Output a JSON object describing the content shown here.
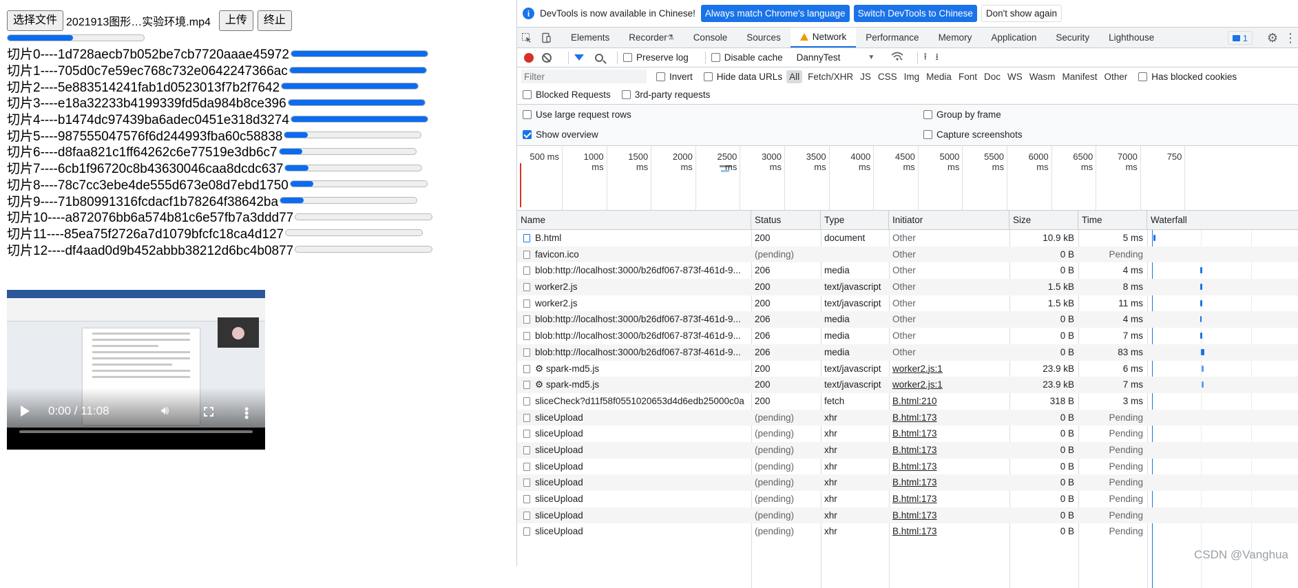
{
  "page": {
    "choose_file_label": "选择文件",
    "file_name": "2021913图形…实验环境.mp4",
    "upload_label": "上传",
    "stop_label": "终止",
    "total_progress": 0.48,
    "slices": [
      {
        "label": "切片0----1d728aecb7b052be7cb7720aaae45972",
        "progress": 1.0
      },
      {
        "label": "切片1----705d0c7e59ec768c732e0642247366ac",
        "progress": 1.0
      },
      {
        "label": "切片2----5e883514241fab1d0523013f7b2f7642",
        "progress": 1.0
      },
      {
        "label": "切片3----e18a32233b4199339fd5da984b8ce396",
        "progress": 1.0
      },
      {
        "label": "切片4----b1474dc97439ba6adec0451e318d3274",
        "progress": 1.0
      },
      {
        "label": "切片5----987555047576f6d244993fba60c58838",
        "progress": 0.17
      },
      {
        "label": "切片6----d8faa821c1ff64262c6e77519e3db6c7",
        "progress": 0.17
      },
      {
        "label": "切片7----6cb1f96720c8b43630046caa8dcdc637",
        "progress": 0.17
      },
      {
        "label": "切片8----78c7cc3ebe4de555d673e08d7ebd1750",
        "progress": 0.17
      },
      {
        "label": "切片9----71b80991316fcdacf1b78264f38642ba",
        "progress": 0.17
      },
      {
        "label": "切片10----a872076bb6a574b81c6e57fb7a3ddd77",
        "progress": 0.0
      },
      {
        "label": "切片11----85ea75f2726a7d1079bfcfc18ca4d127",
        "progress": 0.0
      },
      {
        "label": "切片12----df4aad0d9b452abbb38212d6bc4b0877",
        "progress": 0.0
      }
    ],
    "video": {
      "time": "0:00 / 11:08"
    }
  },
  "devtools": {
    "infobar": {
      "text": "DevTools is now available in Chinese!",
      "btn_match": "Always match Chrome's language",
      "btn_switch": "Switch DevTools to Chinese",
      "btn_dismiss": "Don't show again"
    },
    "tabs": [
      "Elements",
      "Recorder",
      "Console",
      "Sources",
      "Network",
      "Performance",
      "Memory",
      "Application",
      "Security",
      "Lighthouse"
    ],
    "active_tab": "Network",
    "issues_count": "1",
    "toolbar": {
      "preserve_log": "Preserve log",
      "disable_cache": "Disable cache",
      "throttle": "DannyTest"
    },
    "filter": {
      "placeholder": "Filter",
      "invert": "Invert",
      "hide_data_urls": "Hide data URLs",
      "types": [
        "All",
        "Fetch/XHR",
        "JS",
        "CSS",
        "Img",
        "Media",
        "Font",
        "Doc",
        "WS",
        "Wasm",
        "Manifest",
        "Other"
      ],
      "has_blocked_cookies": "Has blocked cookies",
      "blocked_requests": "Blocked Requests",
      "third_party": "3rd-party requests"
    },
    "settings": {
      "large_rows": "Use large request rows",
      "group_by_frame": "Group by frame",
      "show_overview": "Show overview",
      "capture_screenshots": "Capture screenshots"
    },
    "overview_ticks": [
      "500 ms",
      "1000 ms",
      "1500 ms",
      "2000 ms",
      "2500 ms",
      "3000 ms",
      "3500 ms",
      "4000 ms",
      "4500 ms",
      "5000 ms",
      "5500 ms",
      "6000 ms",
      "6500 ms",
      "7000 ms",
      "750"
    ],
    "columns": [
      "Name",
      "Status",
      "Type",
      "Initiator",
      "Size",
      "Time",
      "Waterfall"
    ],
    "rows": [
      {
        "name": "B.html",
        "status": "200",
        "type": "document",
        "initiator": "Other",
        "size": "10.9 kB",
        "time": "5 ms",
        "icon": "doc"
      },
      {
        "name": "favicon.ico",
        "status": "(pending)",
        "type": "",
        "initiator": "Other",
        "size": "0 B",
        "time": "Pending",
        "icon": "file"
      },
      {
        "name": "blob:http://localhost:3000/b26df067-873f-461d-9...",
        "status": "206",
        "type": "media",
        "initiator": "Other",
        "size": "0 B",
        "time": "4 ms",
        "icon": "file"
      },
      {
        "name": "worker2.js",
        "status": "200",
        "type": "text/javascript",
        "initiator": "Other",
        "size": "1.5 kB",
        "time": "8 ms",
        "icon": "file"
      },
      {
        "name": "worker2.js",
        "status": "200",
        "type": "text/javascript",
        "initiator": "Other",
        "size": "1.5 kB",
        "time": "11 ms",
        "icon": "file"
      },
      {
        "name": "blob:http://localhost:3000/b26df067-873f-461d-9...",
        "status": "206",
        "type": "media",
        "initiator": "Other",
        "size": "0 B",
        "time": "4 ms",
        "icon": "file"
      },
      {
        "name": "blob:http://localhost:3000/b26df067-873f-461d-9...",
        "status": "206",
        "type": "media",
        "initiator": "Other",
        "size": "0 B",
        "time": "7 ms",
        "icon": "file"
      },
      {
        "name": "blob:http://localhost:3000/b26df067-873f-461d-9...",
        "status": "206",
        "type": "media",
        "initiator": "Other",
        "size": "0 B",
        "time": "83 ms",
        "icon": "file"
      },
      {
        "name": "⚙ spark-md5.js",
        "status": "200",
        "type": "text/javascript",
        "initiator": "worker2.js:1",
        "size": "23.9 kB",
        "time": "6 ms",
        "icon": "file"
      },
      {
        "name": "⚙ spark-md5.js",
        "status": "200",
        "type": "text/javascript",
        "initiator": "worker2.js:1",
        "size": "23.9 kB",
        "time": "7 ms",
        "icon": "file"
      },
      {
        "name": "sliceCheck?d11f58f0551020653d4d6edb25000c0a",
        "status": "200",
        "type": "fetch",
        "initiator": "B.html:210",
        "size": "318 B",
        "time": "3 ms",
        "icon": "file"
      },
      {
        "name": "sliceUpload",
        "status": "(pending)",
        "type": "xhr",
        "initiator": "B.html:173",
        "size": "0 B",
        "time": "Pending",
        "icon": "file"
      },
      {
        "name": "sliceUpload",
        "status": "(pending)",
        "type": "xhr",
        "initiator": "B.html:173",
        "size": "0 B",
        "time": "Pending",
        "icon": "file"
      },
      {
        "name": "sliceUpload",
        "status": "(pending)",
        "type": "xhr",
        "initiator": "B.html:173",
        "size": "0 B",
        "time": "Pending",
        "icon": "file"
      },
      {
        "name": "sliceUpload",
        "status": "(pending)",
        "type": "xhr",
        "initiator": "B.html:173",
        "size": "0 B",
        "time": "Pending",
        "icon": "file"
      },
      {
        "name": "sliceUpload",
        "status": "(pending)",
        "type": "xhr",
        "initiator": "B.html:173",
        "size": "0 B",
        "time": "Pending",
        "icon": "file"
      },
      {
        "name": "sliceUpload",
        "status": "(pending)",
        "type": "xhr",
        "initiator": "B.html:173",
        "size": "0 B",
        "time": "Pending",
        "icon": "file"
      },
      {
        "name": "sliceUpload",
        "status": "(pending)",
        "type": "xhr",
        "initiator": "B.html:173",
        "size": "0 B",
        "time": "Pending",
        "icon": "file"
      },
      {
        "name": "sliceUpload",
        "status": "(pending)",
        "type": "xhr",
        "initiator": "B.html:173",
        "size": "0 B",
        "time": "Pending",
        "icon": "file"
      }
    ]
  },
  "watermark": "CSDN @Vanghua"
}
